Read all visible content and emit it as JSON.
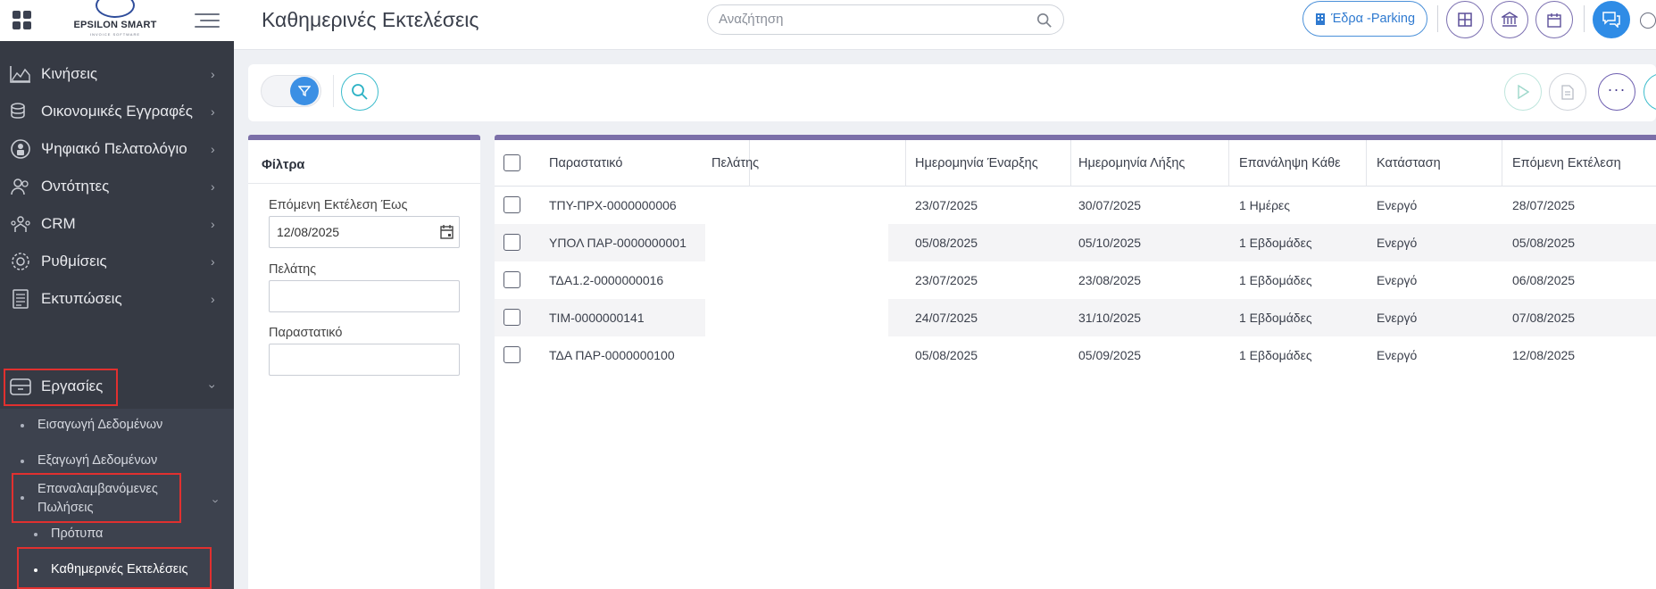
{
  "sidebar": {
    "logo": {
      "name": "EPSILON SMART",
      "sub": "INVOICE SOFTWARE"
    },
    "items": [
      {
        "label": "Κινήσεις",
        "icon": "chart-area-icon"
      },
      {
        "label": "Οικονομικές Εγγραφές",
        "icon": "coins-icon"
      },
      {
        "label": "Ψηφιακό Πελατολόγιο",
        "icon": "user-lock-icon"
      },
      {
        "label": "Οντότητες",
        "icon": "users-icon"
      },
      {
        "label": "CRM",
        "icon": "crm-icon"
      },
      {
        "label": "Ρυθμίσεις",
        "icon": "gear-icon"
      },
      {
        "label": "Εκτυπώσεις",
        "icon": "document-icon"
      },
      {
        "label": "Εργασίες",
        "icon": "archive-box-icon"
      }
    ],
    "sub_items": {
      "import": "Εισαγωγή Δεδομένων",
      "export": "Εξαγωγή Δεδομένων",
      "recurring": "Επαναλαμβανόμενες Πωλήσεις",
      "templates": "Πρότυπα",
      "daily": "Καθημερινές Εκτελέσεις"
    }
  },
  "header": {
    "title": "Καθημερινές Εκτελέσεις",
    "search_placeholder": "Αναζήτηση",
    "branch": "Έδρα -Parking"
  },
  "filters": {
    "title": "Φίλτρα",
    "next_exec_label": "Επόμενη Εκτέλεση Έως",
    "next_exec_value": "12/08/2025",
    "customer_label": "Πελάτης",
    "customer_value": "",
    "document_label": "Παραστατικό",
    "document_value": ""
  },
  "table": {
    "headers": [
      "Παραστατικό",
      "Πελάτης",
      "Ημερομηνία Έναρξης",
      "Ημερομηνία Λήξης",
      "Επανάληψη Κάθε",
      "Κατάσταση",
      "Επόμενη Εκτέλεση"
    ],
    "rows": [
      [
        "ΤΠΥ-ΠΡΧ-0000000006",
        "",
        "23/07/2025",
        "30/07/2025",
        "1 Ημέρες",
        "Ενεργό",
        "28/07/2025"
      ],
      [
        "ΥΠΟΛ ΠΑΡ-0000000001",
        "",
        "05/08/2025",
        "05/10/2025",
        "1 Εβδομάδες",
        "Ενεργό",
        "05/08/2025"
      ],
      [
        "ΤΔΑ1.2-0000000016",
        "",
        "23/07/2025",
        "23/08/2025",
        "1 Εβδομάδες",
        "Ενεργό",
        "06/08/2025"
      ],
      [
        "ΤΙΜ-0000000141",
        "",
        "24/07/2025",
        "31/10/2025",
        "1 Εβδομάδες",
        "Ενεργό",
        "07/08/2025"
      ],
      [
        "ΤΔΑ ΠΑΡ-0000000100",
        "",
        "05/08/2025",
        "05/09/2025",
        "1 Εβδομάδες",
        "Ενεργό",
        "12/08/2025"
      ]
    ]
  },
  "colors": {
    "accent": "#2f8ce6",
    "sidebar": "#363a44",
    "header_border": "#7b6fa8",
    "highlight": "#e1302f"
  }
}
